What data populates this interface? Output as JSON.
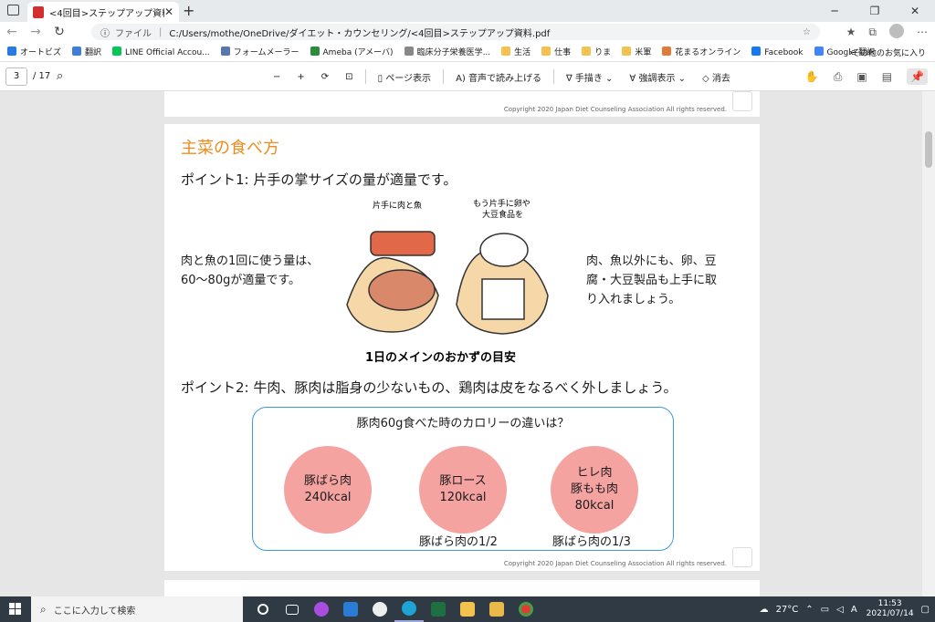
{
  "browser": {
    "tab_title": "<4回目>ステップアップ資料.pdf",
    "new_tab": "+",
    "scheme_label": "ファイル",
    "url": "C:/Users/mothe/OneDrive/ダイエット・カウンセリング/<4回目>ステップアップ資料.pdf",
    "favorites": [
      {
        "label": "オートビズ",
        "color": "#2a7ae4"
      },
      {
        "label": "翻訳",
        "color": "#3f7fd9"
      },
      {
        "label": "LINE Official Accou...",
        "color": "#06c755"
      },
      {
        "label": "フォームメーラー",
        "color": "#5577aa"
      },
      {
        "label": "Ameba (アメーバ)",
        "color": "#2d8c3c"
      },
      {
        "label": "臨床分子栄養医学...",
        "color": "#888888"
      },
      {
        "label": "生活",
        "color": "#f2c14e"
      },
      {
        "label": "仕事",
        "color": "#f2c14e"
      },
      {
        "label": "りま",
        "color": "#f2c14e"
      },
      {
        "label": "米軍",
        "color": "#f2c14e"
      },
      {
        "label": "花まるオンライン",
        "color": "#e07b39"
      },
      {
        "label": "Facebook",
        "color": "#1877f2"
      },
      {
        "label": "Google 翻訳",
        "color": "#4285f4"
      }
    ],
    "other_favorites": "その他のお気に入り"
  },
  "pdf_toolbar": {
    "page": "3",
    "total": "/ 17",
    "page_view": "ページ表示",
    "read_aloud": "音声で読み上げる",
    "draw": "手描き",
    "highlight": "強調表示",
    "erase": "消去"
  },
  "doc": {
    "copyright": "Copyright 2020 Japan Diet Counseling Association All rights reserved.",
    "section_title": "主菜の食べ方",
    "point1": "ポイント1: 片手の掌サイズの量が適量です。",
    "left_text": "肉と魚の1回に使う量は、60〜80gが適量です。",
    "right_text": "肉、魚以外にも、卵、豆腐・大豆製品も上手に取り入れましょう。",
    "illus_label_left": "片手に肉と魚",
    "illus_label_right_1": "もう片手に卵や",
    "illus_label_right_2": "大豆食品を",
    "illus_caption": "1日のメインのおかずの目安",
    "point2": "ポイント2: 牛肉、豚肉は脂身の少ないもの、鶏肉は皮をなるべく外しましょう。",
    "calorie_question": "豚肉60g食べた時のカロリーの違いは？",
    "circles": [
      {
        "name": "豚ばら肉",
        "line2": "",
        "kcal": "240kcal"
      },
      {
        "name": "豚ロース",
        "line2": "",
        "kcal": "120kcal"
      },
      {
        "name": "ヒレ肉",
        "line2": "豚もも肉",
        "kcal": "80kcal"
      }
    ],
    "ratio2": "豚ばら肉の1/2",
    "ratio3": "豚ばら肉の1/3"
  },
  "taskbar": {
    "search_placeholder": "ここに入力して検索",
    "weather": "27°C",
    "ime": "A",
    "time": "11:53",
    "date": "2021/07/14"
  }
}
